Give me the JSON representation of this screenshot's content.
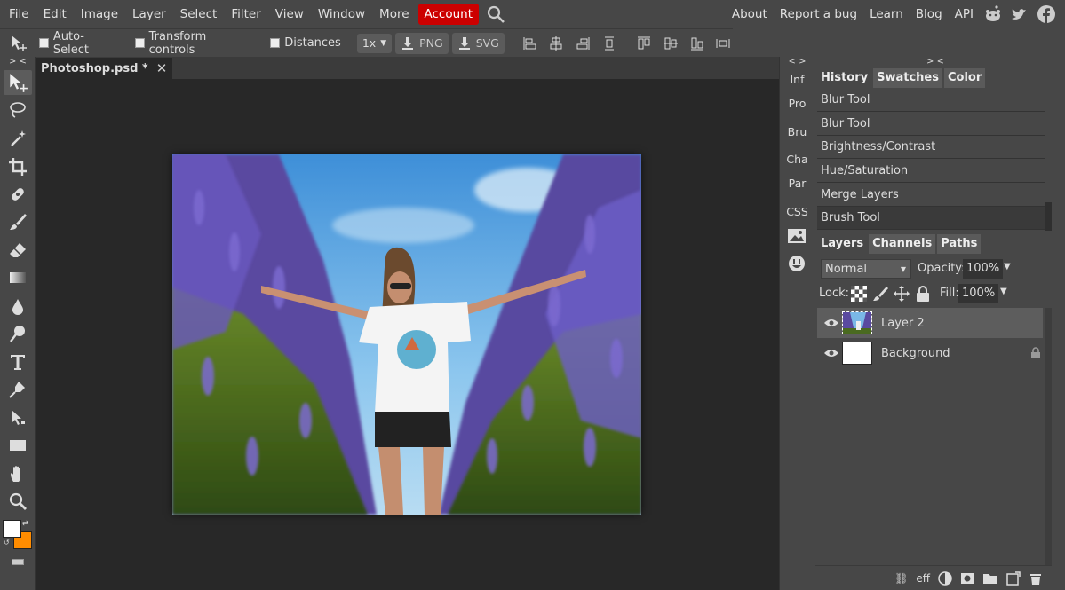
{
  "menubar": {
    "items": [
      "File",
      "Edit",
      "Image",
      "Layer",
      "Select",
      "Filter",
      "View",
      "Window",
      "More"
    ],
    "account": "Account",
    "right_links": [
      "About",
      "Report a bug",
      "Learn",
      "Blog",
      "API"
    ]
  },
  "options": {
    "auto_select": "Auto-Select",
    "transform_controls": "Transform controls",
    "distances": "Distances",
    "zoom_value": "1x",
    "png_label": "PNG",
    "svg_label": "SVG"
  },
  "document": {
    "tab_title": "Photoshop.psd *"
  },
  "panel_toggles": {
    "collapse_label": "> <",
    "mini_label": "< >"
  },
  "mini_panels": [
    "Inf",
    "Pro",
    "Bru",
    "Cha",
    "Par",
    "CSS"
  ],
  "history": {
    "tabs": [
      "History",
      "Swatches",
      "Color"
    ],
    "items": [
      "Blur Tool",
      "Blur Tool",
      "Brightness/Contrast",
      "Hue/Saturation",
      "Merge Layers",
      "Brush Tool"
    ]
  },
  "layers": {
    "tabs": [
      "Layers",
      "Channels",
      "Paths"
    ],
    "blend_mode": "Normal",
    "opacity_label": "Opacity:",
    "opacity_value": "100%",
    "lock_label": "Lock:",
    "fill_label": "Fill:",
    "fill_value": "100%",
    "items": [
      {
        "name": "Layer 2"
      },
      {
        "name": "Background"
      }
    ],
    "footer_eff": "eff"
  },
  "colors": {
    "foreground": "#ffffff",
    "background": "#ff8c00",
    "account": "#cc0000"
  }
}
